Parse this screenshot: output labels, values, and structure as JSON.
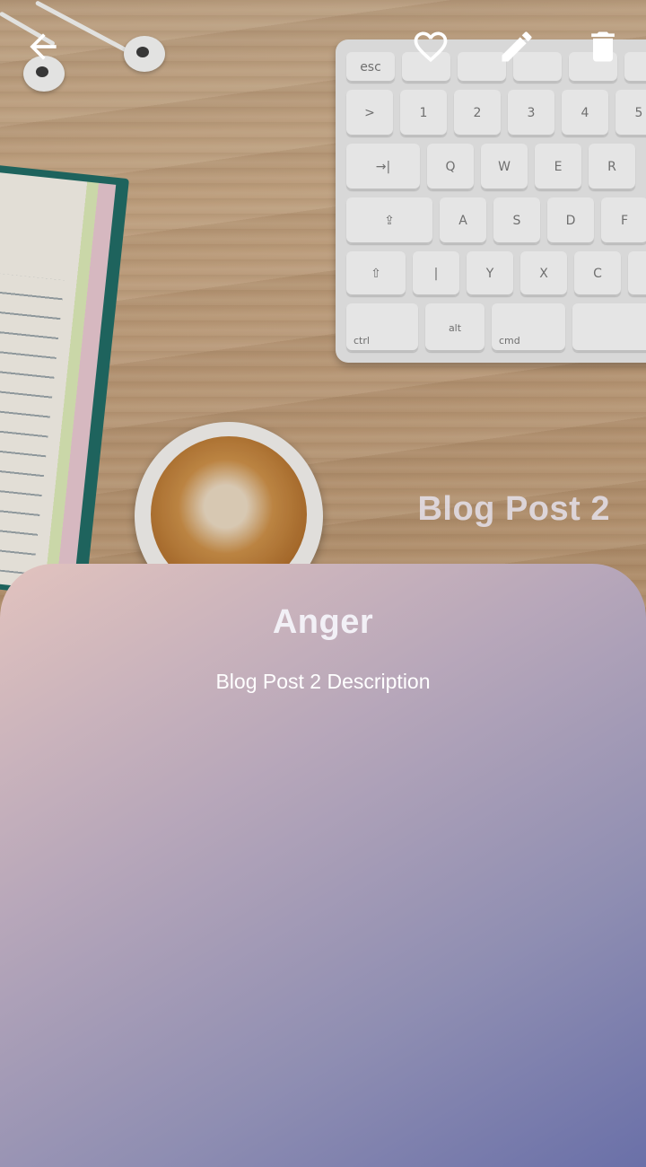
{
  "toolbar": {
    "back_icon": "arrow-left-icon",
    "favorite_icon": "heart-outline-icon",
    "edit_icon": "pencil-icon",
    "delete_icon": "trash-icon"
  },
  "post": {
    "title": "Blog Post 2",
    "emotion": "Anger",
    "description": "Blog Post 2 Description"
  },
  "keyboard": {
    "row1": [
      "esc",
      "",
      "",
      "",
      "",
      ""
    ],
    "row2": [
      ">\n<",
      "1",
      "2",
      "3",
      "4",
      "5"
    ],
    "row3": [
      "→|",
      "Q",
      "W",
      "E",
      "R"
    ],
    "row4": [
      "⇪",
      "A",
      "S",
      "D",
      "F"
    ],
    "row5": [
      "⇧",
      "|",
      "Y",
      "X",
      "C",
      ""
    ],
    "row6": [
      "ctrl",
      "alt",
      "cmd",
      ""
    ]
  },
  "colors": {
    "card_gradient_start": "#e2c3be",
    "card_gradient_end": "#6a70a8",
    "icon_color": "#ffffff"
  }
}
